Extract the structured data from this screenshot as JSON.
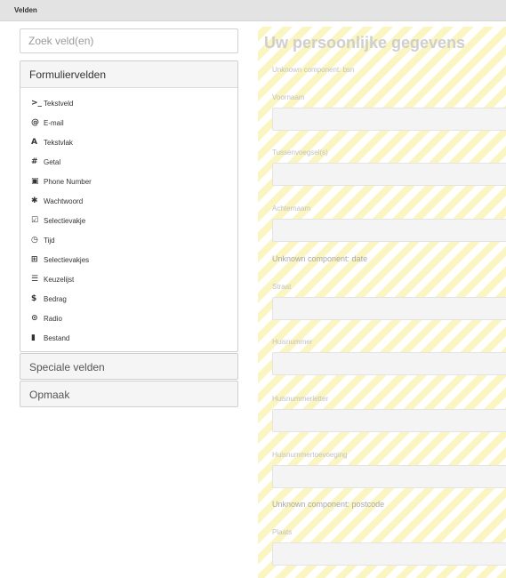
{
  "topbar": {
    "title": "Velden"
  },
  "search": {
    "placeholder": "Zoek veld(en)"
  },
  "panel": {
    "title": "Formuliervelden",
    "items": [
      {
        "icon": "terminal-icon",
        "glyph": ">_",
        "label": "Tekstveld"
      },
      {
        "icon": "at-icon",
        "glyph": "@",
        "label": "E-mail"
      },
      {
        "icon": "font-icon",
        "glyph": "A",
        "label": "Tekstvlak"
      },
      {
        "icon": "hash-icon",
        "glyph": "#",
        "label": "Getal"
      },
      {
        "icon": "phone-square-icon",
        "glyph": "▣",
        "label": "Phone Number"
      },
      {
        "icon": "asterisk-icon",
        "glyph": "✱",
        "label": "Wachtwoord"
      },
      {
        "icon": "check-square-icon",
        "glyph": "☑",
        "label": "Selectievakje"
      },
      {
        "icon": "clock-icon",
        "glyph": "◷",
        "label": "Tijd"
      },
      {
        "icon": "plus-square-icon",
        "glyph": "⊞",
        "label": "Selectievakjes"
      },
      {
        "icon": "list-icon",
        "glyph": "☰",
        "label": "Keuzelijst"
      },
      {
        "icon": "dollar-icon",
        "glyph": "$",
        "label": "Bedrag"
      },
      {
        "icon": "radio-icon",
        "glyph": "⊙",
        "label": "Radio"
      },
      {
        "icon": "file-icon",
        "glyph": "▮",
        "label": "Bestand"
      }
    ]
  },
  "sections": {
    "special": "Speciale velden",
    "layout": "Opmaak"
  },
  "form": {
    "title": "Uw persoonlijke gegevens",
    "unknown_bsn": "Unknown component: bsn",
    "label_voornaam": "Voornaam",
    "label_tussenvoegsel": "Tussenvoegsel(s)",
    "label_achternaam": "Achternaam",
    "unknown_date": "Unknown component: date",
    "label_straat": "Straat",
    "label_huisnummer": "Huisnummer",
    "label_huisnummerletter": "Huisnummerletter",
    "label_huisnummertoevoeging": "Huisnummertoevoeging",
    "unknown_postcode": "Unknown component: postcode",
    "label_plaats": "Plaats"
  }
}
